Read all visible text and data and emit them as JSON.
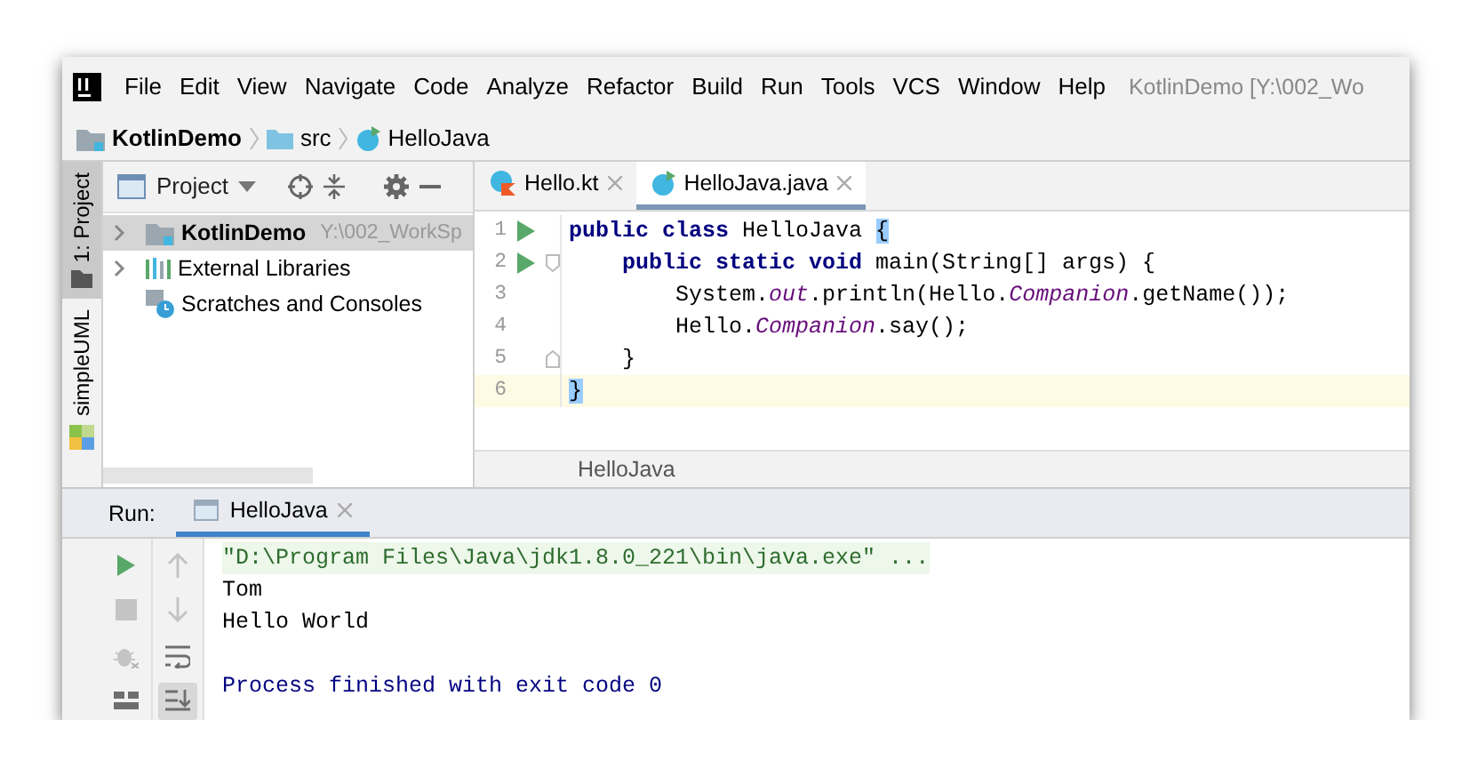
{
  "window": {
    "title": "KotlinDemo [Y:\\002_Wo"
  },
  "menu": [
    "File",
    "Edit",
    "View",
    "Navigate",
    "Code",
    "Analyze",
    "Refactor",
    "Build",
    "Run",
    "Tools",
    "VCS",
    "Window",
    "Help"
  ],
  "breadcrumb": [
    {
      "kind": "project",
      "label": "KotlinDemo"
    },
    {
      "kind": "folder",
      "label": "src"
    },
    {
      "kind": "class",
      "label": "HelloJava"
    }
  ],
  "tool_strip": [
    {
      "label": "1: Project",
      "kind": "folder",
      "selected": true
    },
    {
      "label": "simpleUML",
      "kind": "uml",
      "selected": false
    }
  ],
  "project_panel": {
    "title": "Project",
    "tree": [
      {
        "kind": "module",
        "label": "KotlinDemo",
        "detail": "Y:\\002_WorkSp",
        "expandable": true,
        "selected": true
      },
      {
        "kind": "libraries",
        "label": "External Libraries",
        "expandable": true,
        "selected": false
      },
      {
        "kind": "scratches",
        "label": "Scratches and Consoles",
        "expandable": false,
        "selected": false
      }
    ]
  },
  "editor": {
    "tabs": [
      {
        "kind": "kotlin",
        "label": "Hello.kt",
        "selected": false
      },
      {
        "kind": "java",
        "label": "HelloJava.java",
        "selected": true
      }
    ],
    "lines": [
      {
        "number": "1",
        "run": true,
        "fold_start": false,
        "fold_end": false,
        "current": false,
        "tokens": [
          {
            "kind": "keyword",
            "text": "public class "
          },
          {
            "kind": "plain",
            "text": "HelloJava "
          },
          {
            "kind": "brace_match",
            "text": "{"
          }
        ]
      },
      {
        "number": "2",
        "run": true,
        "fold_start": true,
        "fold_end": false,
        "current": false,
        "tokens": [
          {
            "kind": "keyword",
            "text": "    public static void "
          },
          {
            "kind": "plain",
            "text": "main(String[] args) {"
          }
        ]
      },
      {
        "number": "3",
        "run": false,
        "fold_start": false,
        "fold_end": false,
        "current": false,
        "tokens": [
          {
            "kind": "plain",
            "text": "        System."
          },
          {
            "kind": "static_field",
            "text": "out"
          },
          {
            "kind": "plain",
            "text": ".println(Hello."
          },
          {
            "kind": "static_field",
            "text": "Companion"
          },
          {
            "kind": "plain",
            "text": ".getName());"
          }
        ]
      },
      {
        "number": "4",
        "run": false,
        "fold_start": false,
        "fold_end": false,
        "current": false,
        "tokens": [
          {
            "kind": "plain",
            "text": "        Hello."
          },
          {
            "kind": "static_field",
            "text": "Companion"
          },
          {
            "kind": "plain",
            "text": ".say();"
          }
        ]
      },
      {
        "number": "5",
        "run": false,
        "fold_start": false,
        "fold_end": true,
        "current": false,
        "tokens": [
          {
            "kind": "plain",
            "text": "    }"
          }
        ]
      },
      {
        "number": "6",
        "run": false,
        "fold_start": false,
        "fold_end": false,
        "current": true,
        "tokens": [
          {
            "kind": "brace_match",
            "text": "}"
          }
        ]
      }
    ],
    "footer": "HelloJava"
  },
  "run_panel": {
    "label": "Run:",
    "tab": {
      "label": "HelloJava",
      "selected": true
    },
    "actions": [
      {
        "kind": "run"
      },
      {
        "kind": "stop"
      },
      {
        "kind": "debug"
      },
      {
        "kind": "layout"
      }
    ],
    "console_tools": [
      {
        "kind": "up",
        "selected": false
      },
      {
        "kind": "down",
        "selected": false
      },
      {
        "kind": "wrap",
        "selected": false
      },
      {
        "kind": "scroll_end",
        "selected": true
      }
    ],
    "console": [
      {
        "kind": "command",
        "text": "\"D:\\Program Files\\Java\\jdk1.8.0_221\\bin\\java.exe\" ..."
      },
      {
        "kind": "output",
        "text": "Tom"
      },
      {
        "kind": "output",
        "text": "Hello World"
      },
      {
        "kind": "system",
        "text": "Process finished with exit code 0"
      }
    ]
  }
}
